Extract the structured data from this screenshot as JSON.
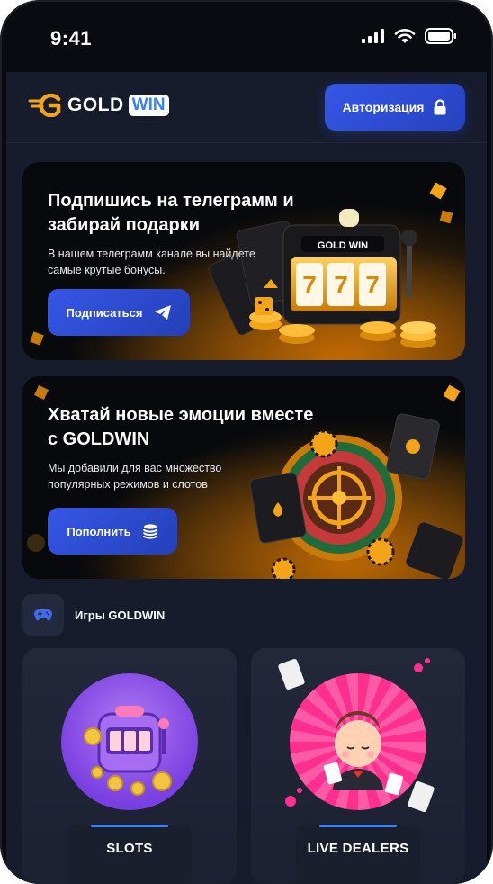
{
  "status_bar": {
    "time": "9:41"
  },
  "header": {
    "logo_text": "GOLD",
    "logo_accent": "WIN",
    "auth_label": "Авторизация"
  },
  "banner_telegram": {
    "title": "Подпишись на телеграмм и забирай подарки",
    "text": "В нашем телеграмм канале вы найдете самые крутые бонусы.",
    "button_label": "Подписаться",
    "machine_logo": "GOLD WIN",
    "reels": [
      "7",
      "7",
      "7"
    ]
  },
  "banner_deposit": {
    "title": "Хватай новые эмоции вместе с GOLDWIN",
    "text": "Мы добавили для вас множество популярных режимов и слотов",
    "button_label": "Пополнить"
  },
  "games_section": {
    "title": "Игры GOLDWIN"
  },
  "game_cards": [
    {
      "label": "SLOTS"
    },
    {
      "label": "LIVE DEALERS"
    }
  ],
  "colors": {
    "background": "#171c2c",
    "accent_blue": "#3557e6",
    "gold": "#f3a418",
    "card": "#22283a"
  }
}
